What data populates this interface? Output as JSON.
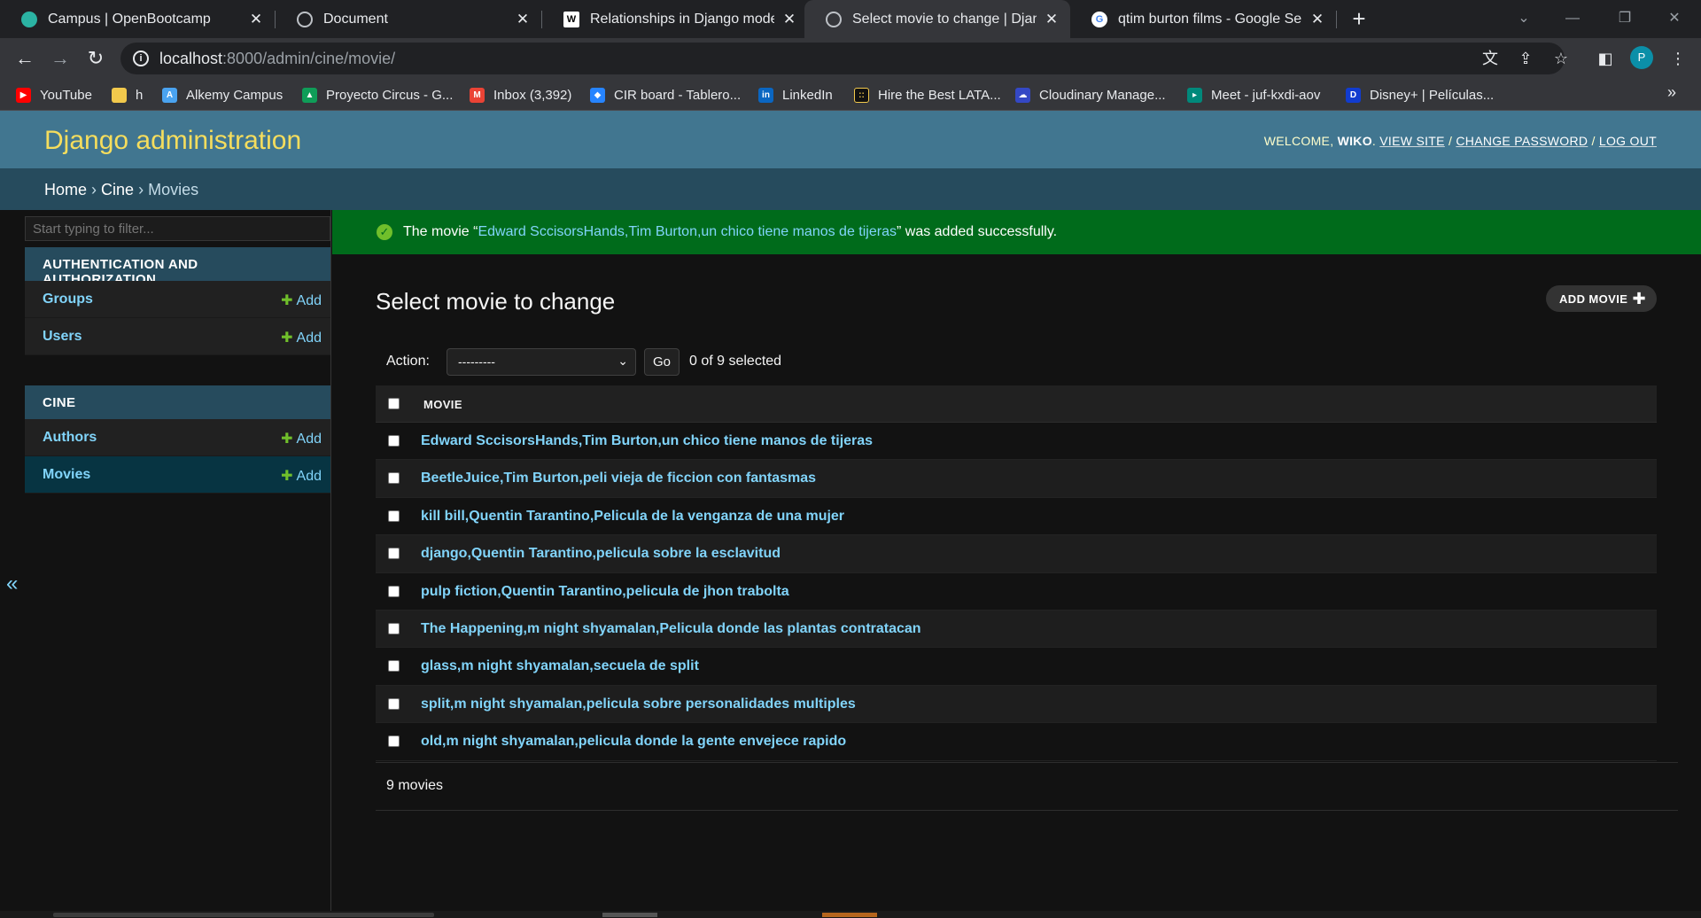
{
  "browser": {
    "tabs": [
      {
        "title": "Campus | OpenBootcamp",
        "icon": "openbootcamp-icon"
      },
      {
        "title": "Document",
        "icon": "globe-icon"
      },
      {
        "title": "Relationships in Django models",
        "icon": "medium-icon"
      },
      {
        "title": "Select movie to change | Django",
        "icon": "globe-icon",
        "active": true
      },
      {
        "title": "qtim burton films - Google Searc",
        "icon": "google-icon"
      }
    ],
    "close_glyph": "✕",
    "new_tab": "+",
    "url_host": "localhost",
    "url_path": ":8000/admin/cine/movie/",
    "profile_initial": "P",
    "bookmarks": [
      {
        "label": "YouTube",
        "color": "#ff0000"
      },
      {
        "label": "h",
        "color": "#f2c94c"
      },
      {
        "label": "Alkemy Campus",
        "color": "#4aa3f0"
      },
      {
        "label": "Proyecto Circus - G...",
        "color": "#0f9d58"
      },
      {
        "label": "Inbox (3,392)",
        "color": "#ea4335"
      },
      {
        "label": "CIR board - Tablero...",
        "color": "#2684ff"
      },
      {
        "label": "LinkedIn",
        "color": "#0a66c2"
      },
      {
        "label": "Hire the Best LATA...",
        "color": "#111111"
      },
      {
        "label": "Cloudinary Manage...",
        "color": "#3448c5"
      },
      {
        "label": "Meet - juf-kxdi-aov",
        "color": "#00897b"
      },
      {
        "label": "Disney+ | Películas...",
        "color": "#113ccf"
      }
    ],
    "more_glyph": "»"
  },
  "header": {
    "brand": "Django administration",
    "welcome": "WELCOME,",
    "username": "WIKO",
    "view_site": "VIEW SITE",
    "change_password": "CHANGE PASSWORD",
    "log_out": "LOG OUT"
  },
  "breadcrumbs": {
    "home": "Home",
    "app": "Cine",
    "model": "Movies",
    "sep": "›"
  },
  "sidebar": {
    "filter_placeholder": "Start typing to filter...",
    "collapse_glyph": "«",
    "auth": {
      "caption": "AUTHENTICATION AND AUTHORIZATION",
      "items": [
        {
          "label": "Groups",
          "add": "Add"
        },
        {
          "label": "Users",
          "add": "Add"
        }
      ]
    },
    "cine": {
      "caption": "CINE",
      "items": [
        {
          "label": "Authors",
          "add": "Add"
        },
        {
          "label": "Movies",
          "add": "Add"
        }
      ]
    }
  },
  "message": {
    "prefix": "The movie “",
    "link": "Edward SccisorsHands,Tim Burton,un chico tiene manos de tijeras",
    "suffix": "” was added successfully."
  },
  "content": {
    "title": "Select movie to change",
    "add_button": "ADD MOVIE",
    "action_label": "Action:",
    "action_selected": "---------",
    "go": "Go",
    "selected_count": "0 of 9 selected",
    "column_header": "MOVIE",
    "rows": [
      "Edward SccisorsHands,Tim Burton,un chico tiene manos de tijeras",
      "BeetleJuice,Tim Burton,peli vieja de ficcion con fantasmas",
      "kill bill,Quentin Tarantino,Pelicula de la venganza de una mujer",
      "django,Quentin Tarantino,pelicula sobre la esclavitud",
      "pulp fiction,Quentin Tarantino,pelicula de jhon trabolta",
      "The Happening,m night shyamalan,Pelicula donde las plantas contratacan",
      "glass,m night shyamalan,secuela de split",
      "split,m night shyamalan,pelicula sobre personalidades multiples",
      "old,m night shyamalan,pelicula donde la gente envejece rapido"
    ],
    "paginator": "9 movies"
  },
  "colors": {
    "header_bg": "#417690",
    "crumbs_bg": "#264b5d",
    "link": "#81d4fa",
    "success_bg": "#006b1b",
    "brand": "#f5dd5d"
  }
}
